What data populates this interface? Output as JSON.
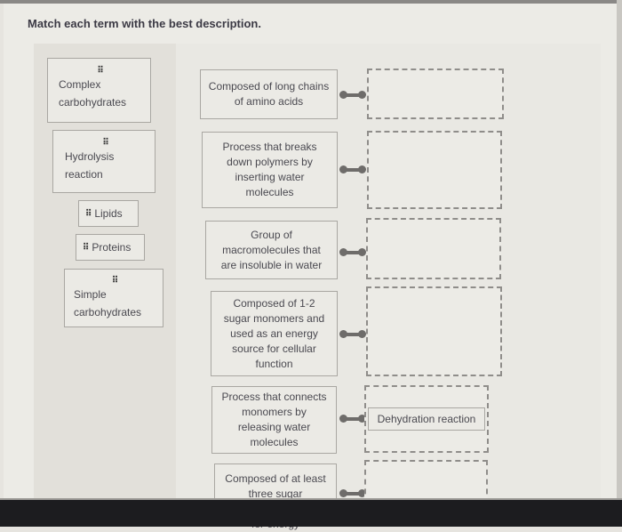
{
  "question": {
    "title": "Match each term with the best description."
  },
  "terms": [
    {
      "label": "Complex carbohydrates",
      "line1": "Complex",
      "line2": "carbohydrates",
      "grip_icon": "drag-handle-icon"
    },
    {
      "label": "Hydrolysis reaction",
      "line1": "Hydrolysis",
      "line2": "reaction",
      "grip_icon": "drag-handle-icon"
    },
    {
      "label": "Lipids",
      "grip_icon": "drag-handle-icon"
    },
    {
      "label": "Proteins",
      "grip_icon": "drag-handle-icon"
    },
    {
      "label": "Simple carbohydrates",
      "line1": "Simple",
      "line2": "carbohydrates",
      "grip_icon": "drag-handle-icon"
    }
  ],
  "grip_glyph": "⠿",
  "descriptions": [
    {
      "text": "Composed of long chains of amino acids",
      "answer": ""
    },
    {
      "text": "Process that breaks down polymers by inserting water molecules",
      "answer": ""
    },
    {
      "text": "Group of macromolecules that are insoluble in water",
      "answer": ""
    },
    {
      "text": "Composed of 1-2 sugar monomers and used as an energy source for cellular function",
      "answer": ""
    },
    {
      "text": "Process that connects monomers by releasing water molecules",
      "answer": "Dehydration reaction"
    },
    {
      "text": "Composed of at least three sugar monomers and used for energy",
      "answer": ""
    }
  ]
}
